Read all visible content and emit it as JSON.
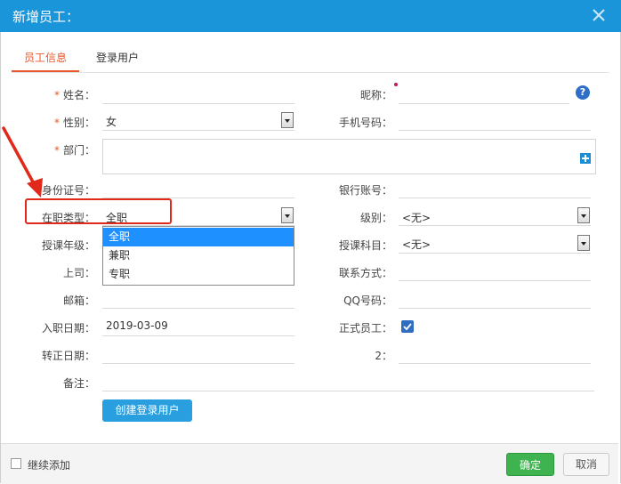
{
  "dialog": {
    "title": "新增员工："
  },
  "tabs": [
    {
      "label": "员工信息"
    },
    {
      "label": "登录用户"
    }
  ],
  "fields": {
    "name": {
      "label": "姓名："
    },
    "nickname": {
      "label": "昵称："
    },
    "gender": {
      "label": "性别：",
      "value": "女"
    },
    "mobile": {
      "label": "手机号码："
    },
    "department": {
      "label": "部门："
    },
    "id_number": {
      "label": "身份证号："
    },
    "bank_account": {
      "label": "银行账号："
    },
    "employment_type": {
      "label": "在职类型：",
      "value": "全职"
    },
    "level": {
      "label": "级别：",
      "value": "<无>"
    },
    "teaching_grade": {
      "label": "授课年级："
    },
    "teaching_subject": {
      "label": "授课科目：",
      "value": "<无>"
    },
    "supervisor": {
      "label": "上司："
    },
    "contact": {
      "label": "联系方式："
    },
    "email": {
      "label": "邮箱："
    },
    "qq": {
      "label": "QQ号码："
    },
    "hire_date": {
      "label": "入职日期：",
      "value": "2019-03-09"
    },
    "regular_employee": {
      "label": "正式员工："
    },
    "confirm_date": {
      "label": "转正日期："
    },
    "field2": {
      "label": "2："
    },
    "remark": {
      "label": "备注："
    }
  },
  "employment_options": [
    "全职",
    "兼职",
    "专职"
  ],
  "required_mark": "*",
  "help_mark": "?",
  "buttons": {
    "create_login": "创建登录用户",
    "ok": "确定",
    "cancel": "取消"
  },
  "footer": {
    "continue_label": "继续添加"
  },
  "colors": {
    "header": "#1a95d9",
    "accent": "#e8572b",
    "ok": "#3fb34f",
    "highlight": "#e0291b"
  }
}
